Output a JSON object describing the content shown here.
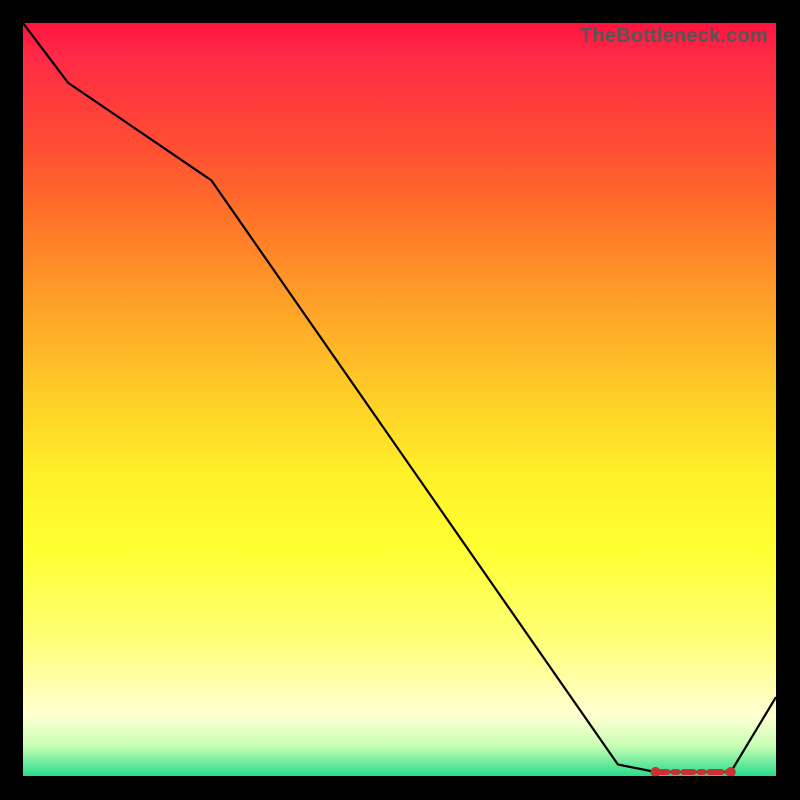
{
  "watermark": "TheBottleneck.com",
  "colors": {
    "top": "#ff143e",
    "bottom": "#28dc8c",
    "line": "#000000",
    "marker": "#c83232",
    "text": "#565656"
  },
  "chart_data": {
    "type": "line",
    "title": "",
    "xlabel": "",
    "ylabel": "",
    "x": [
      0.0,
      0.06,
      0.25,
      0.79,
      0.84,
      0.94,
      1.0
    ],
    "values": [
      100,
      92,
      79,
      1,
      0,
      0,
      10
    ],
    "ylim": [
      0,
      100
    ],
    "xlim": [
      0,
      1
    ],
    "annotations": [
      {
        "type": "flat_marker",
        "x_start": 0.84,
        "x_end": 0.94,
        "y": 0
      }
    ]
  }
}
